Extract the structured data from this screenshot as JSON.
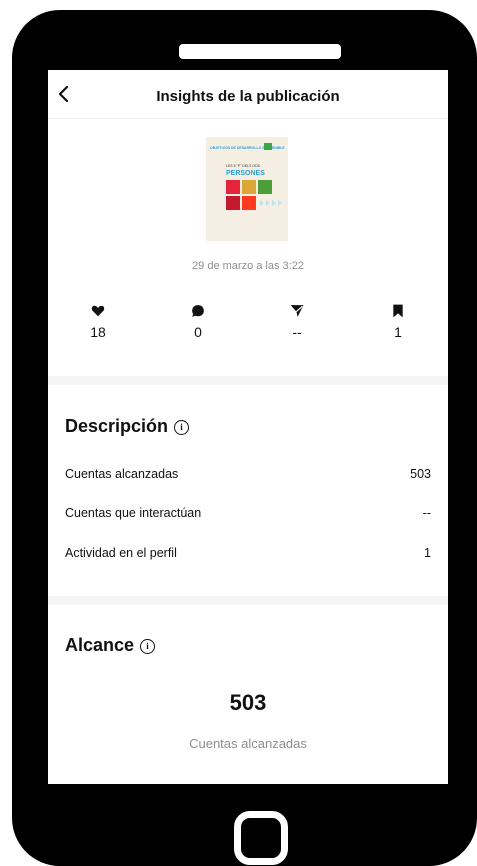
{
  "header": {
    "title": "Insights de la publicación"
  },
  "post": {
    "date": "29 de marzo a las 3:22",
    "thumb_heading": "PERSONES",
    "thumb_title": "OBJETIVOS DE DESARROLLO SOSTENIBLE",
    "thumb_sub": "LES 5 \"P\" DELS ODS"
  },
  "stats": [
    {
      "icon": "heart-icon",
      "value": "18"
    },
    {
      "icon": "comment-icon",
      "value": "0"
    },
    {
      "icon": "send-icon",
      "value": "--"
    },
    {
      "icon": "bookmark-icon",
      "value": "1"
    }
  ],
  "descripcion": {
    "title": "Descripción",
    "rows": [
      {
        "label": "Cuentas alcanzadas",
        "value": "503"
      },
      {
        "label": "Cuentas que interactúan",
        "value": "--"
      },
      {
        "label": "Actividad en el perfil",
        "value": "1"
      }
    ]
  },
  "alcance": {
    "title": "Alcance",
    "number": "503",
    "label": "Cuentas alcanzadas"
  },
  "colors": {
    "accent": "#111111",
    "muted": "#8e8e8e",
    "divider": "#f5f5f5"
  }
}
